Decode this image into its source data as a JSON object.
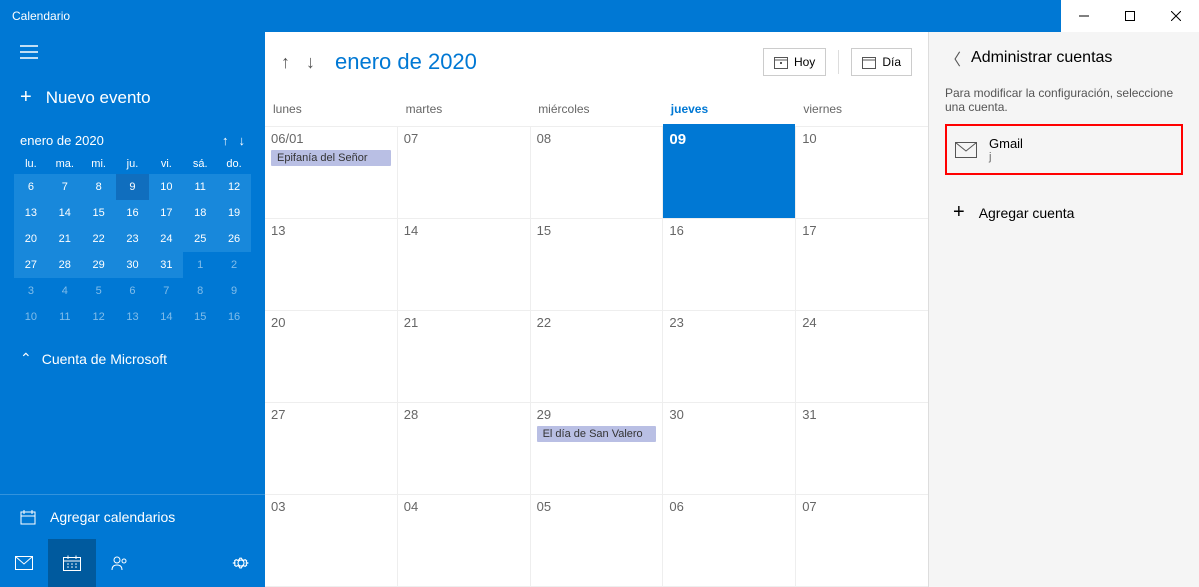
{
  "window": {
    "title": "Calendario"
  },
  "sidebar": {
    "newEvent": "Nuevo evento",
    "miniMonth": "enero de 2020",
    "dow": [
      "lu.",
      "ma.",
      "mi.",
      "ju.",
      "vi.",
      "sá.",
      "do."
    ],
    "miniDays": [
      {
        "n": "6"
      },
      {
        "n": "7"
      },
      {
        "n": "8"
      },
      {
        "n": "9",
        "today": true
      },
      {
        "n": "10"
      },
      {
        "n": "11"
      },
      {
        "n": "12"
      },
      {
        "n": "13"
      },
      {
        "n": "14"
      },
      {
        "n": "15"
      },
      {
        "n": "16"
      },
      {
        "n": "17"
      },
      {
        "n": "18"
      },
      {
        "n": "19"
      },
      {
        "n": "20"
      },
      {
        "n": "21"
      },
      {
        "n": "22"
      },
      {
        "n": "23"
      },
      {
        "n": "24"
      },
      {
        "n": "25"
      },
      {
        "n": "26"
      },
      {
        "n": "27"
      },
      {
        "n": "28"
      },
      {
        "n": "29"
      },
      {
        "n": "30"
      },
      {
        "n": "31"
      },
      {
        "n": "1",
        "faded": true
      },
      {
        "n": "2",
        "faded": true
      },
      {
        "n": "3",
        "faded": true
      },
      {
        "n": "4",
        "faded": true
      },
      {
        "n": "5",
        "faded": true
      },
      {
        "n": "6",
        "faded": true
      },
      {
        "n": "7",
        "faded": true
      },
      {
        "n": "8",
        "faded": true
      },
      {
        "n": "9",
        "faded": true
      },
      {
        "n": "10",
        "faded": true
      },
      {
        "n": "11",
        "faded": true
      },
      {
        "n": "12",
        "faded": true
      },
      {
        "n": "13",
        "faded": true
      },
      {
        "n": "14",
        "faded": true
      },
      {
        "n": "15",
        "faded": true
      },
      {
        "n": "16",
        "faded": true
      }
    ],
    "accountsHeader": "Cuenta de Microsoft",
    "addCalendars": "Agregar calendarios"
  },
  "calendar": {
    "title": "enero de 2020",
    "todayBtn": "Hoy",
    "dayBtn": "Día",
    "dow": [
      "lunes",
      "martes",
      "miércoles",
      "jueves",
      "viernes"
    ],
    "todayCol": 3,
    "weeks": [
      [
        {
          "n": "06/01",
          "events": [
            "Epifanía del Señor"
          ]
        },
        {
          "n": "07"
        },
        {
          "n": "08"
        },
        {
          "n": "09",
          "today": true
        },
        {
          "n": "10"
        }
      ],
      [
        {
          "n": "13"
        },
        {
          "n": "14"
        },
        {
          "n": "15"
        },
        {
          "n": "16"
        },
        {
          "n": "17"
        }
      ],
      [
        {
          "n": "20"
        },
        {
          "n": "21"
        },
        {
          "n": "22"
        },
        {
          "n": "23"
        },
        {
          "n": "24"
        }
      ],
      [
        {
          "n": "27"
        },
        {
          "n": "28"
        },
        {
          "n": "29",
          "events": [
            "El día de San Valero"
          ]
        },
        {
          "n": "30"
        },
        {
          "n": "31"
        }
      ],
      [
        {
          "n": "03"
        },
        {
          "n": "04"
        },
        {
          "n": "05"
        },
        {
          "n": "06"
        },
        {
          "n": "07"
        }
      ]
    ]
  },
  "panel": {
    "title": "Administrar cuentas",
    "desc": "Para modificar la configuración, seleccione una cuenta.",
    "account": {
      "name": "Gmail",
      "sub": "j"
    },
    "addAccount": "Agregar cuenta"
  }
}
